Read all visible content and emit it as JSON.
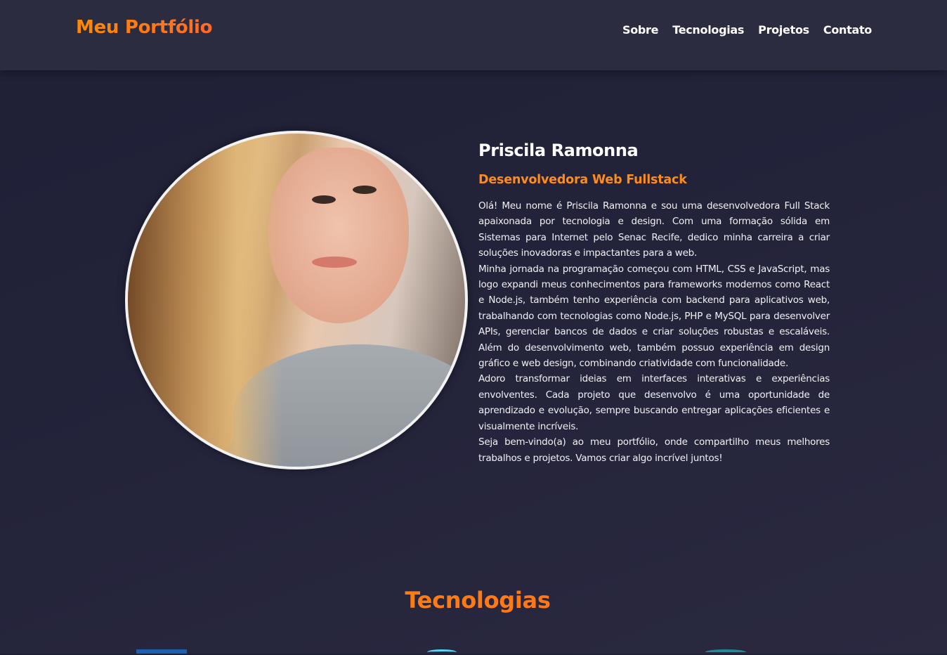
{
  "header": {
    "logo": "Meu Portfólio",
    "nav": [
      "Sobre",
      "Tecnologias",
      "Projetos",
      "Contato"
    ]
  },
  "about": {
    "name": "Priscila Ramonna",
    "role": "Desenvolvedora Web Fullstack",
    "paragraphs": [
      "Olá! Meu nome é Priscila Ramonna e sou uma desenvolvedora Full Stack apaixonada por tecnologia e design. Com uma formação sólida em Sistemas para Internet pelo Senac Recife, dedico minha carreira a criar soluções inovadoras e impactantes para a web.",
      "Minha jornada na programação começou com HTML, CSS e JavaScript, mas logo expandi meus conhecimentos para frameworks modernos como React e Node.js, também tenho experiência com backend para aplicativos web, trabalhando com tecnologias como Node.js, PHP e MySQL para desenvolver APIs, gerenciar bancos de dados e criar soluções robustas e escaláveis. Além do desenvolvimento web, também possuo experiência em design gráfico e web design, combinando criatividade com funcionalidade.",
      "Adoro transformar ideias em interfaces interativas e experiências envolventes. Cada projeto que desenvolvo é uma oportunidade de aprendizado e evolução, sempre buscando entregar aplicações eficientes e visualmente incríveis.",
      "Seja bem-vindo(a) ao meu portfólio, onde compartilho meus melhores trabalhos e projetos. Vamos criar algo incrível juntos!"
    ]
  },
  "technologies": {
    "title": "Tecnologias"
  },
  "colors": {
    "accent": "#ff8c1a",
    "header_bg": "#2c2c41",
    "page_bg": "#23233a"
  }
}
